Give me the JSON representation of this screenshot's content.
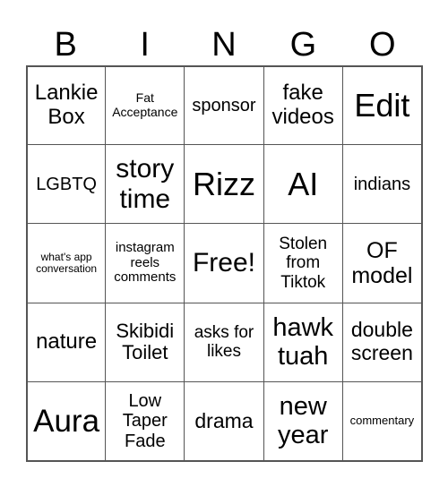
{
  "header": {
    "letters": [
      "B",
      "I",
      "N",
      "G",
      "O"
    ]
  },
  "cells": [
    "Lankie Box",
    "Fat Acceptance",
    "sponsor",
    "fake videos",
    "Edit",
    "LGBTQ",
    "story time",
    "Rizz",
    "AI",
    "indians",
    "what's app conversation",
    "instagram reels comments",
    "Free!",
    "Stolen from Tiktok",
    "OF model",
    "nature",
    "Skibidi Toilet",
    "asks for likes",
    "hawk tuah",
    "double screen",
    "Aura",
    "Low Taper Fade",
    "drama",
    "new year",
    "commentary"
  ]
}
